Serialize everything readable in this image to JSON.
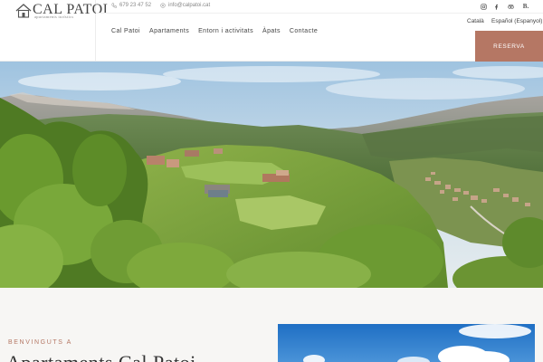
{
  "logo": {
    "title": "CAL PATOI",
    "subtitle": "apartaments turístics"
  },
  "contact": {
    "phone": "679 23 47 52",
    "email": "info@calpatoi.cat"
  },
  "social": [
    {
      "icon": "instagram-icon"
    },
    {
      "icon": "facebook-icon"
    },
    {
      "icon": "tripadvisor-icon"
    },
    {
      "icon": "booking-icon",
      "label": "B."
    }
  ],
  "nav": [
    {
      "label": "Cal Patoi"
    },
    {
      "label": "Apartaments"
    },
    {
      "label": "Entorn i activitats"
    },
    {
      "label": "Àpats"
    },
    {
      "label": "Contacte"
    }
  ],
  "languages": [
    {
      "label": "Català"
    },
    {
      "label": "Español (Espanyol)"
    }
  ],
  "reserva": {
    "label": "RESERVA"
  },
  "welcome": {
    "kicker": "BENVINGUTS A",
    "title": "Apartaments Cal Patoi"
  },
  "colors": {
    "accent": "#b57764",
    "nav_text": "#444444",
    "muted": "#888888"
  }
}
